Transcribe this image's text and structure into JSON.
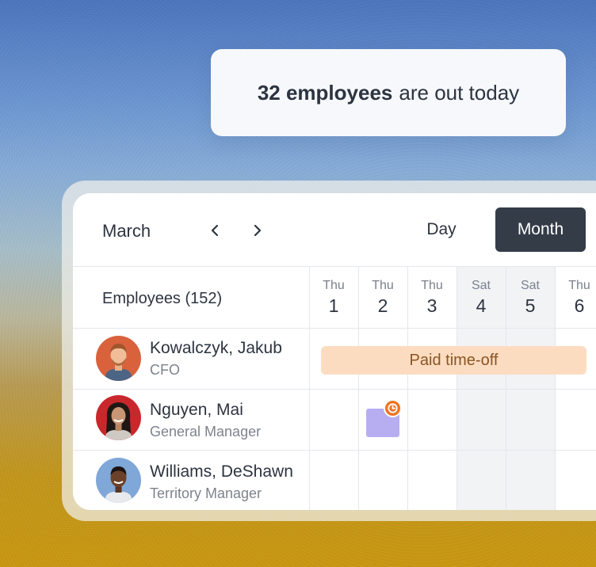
{
  "summary": {
    "count_text": "32 employees",
    "rest_text": "are out today"
  },
  "calendar": {
    "month_label": "March",
    "views": {
      "day": "Day",
      "month": "Month",
      "active": "Month"
    },
    "employees_header": "Employees (152)",
    "days": [
      {
        "name": "Thu",
        "num": "1",
        "weekend": false
      },
      {
        "name": "Thu",
        "num": "2",
        "weekend": false
      },
      {
        "name": "Thu",
        "num": "3",
        "weekend": false
      },
      {
        "name": "Sat",
        "num": "4",
        "weekend": true
      },
      {
        "name": "Sat",
        "num": "5",
        "weekend": true
      },
      {
        "name": "Thu",
        "num": "6",
        "weekend": false
      }
    ],
    "employees": [
      {
        "name": "Kowalczyk, Jakub",
        "role": "CFO",
        "avatar_bg": "#d9623d"
      },
      {
        "name": "Nguyen, Mai",
        "role": "General Manager",
        "avatar_bg": "#c8282c"
      },
      {
        "name": "Williams, DeShawn",
        "role": "Territory Manager",
        "avatar_bg": "#7fa7d8"
      }
    ],
    "events": {
      "pto_label": "Paid time-off"
    }
  },
  "colors": {
    "accent_dark": "#343c48",
    "pto_bg": "#fcdcc1",
    "request_bg": "#b7aef1",
    "pending": "#f07420"
  },
  "icons": [
    "chevron-left-icon",
    "chevron-right-icon",
    "clock-icon"
  ]
}
